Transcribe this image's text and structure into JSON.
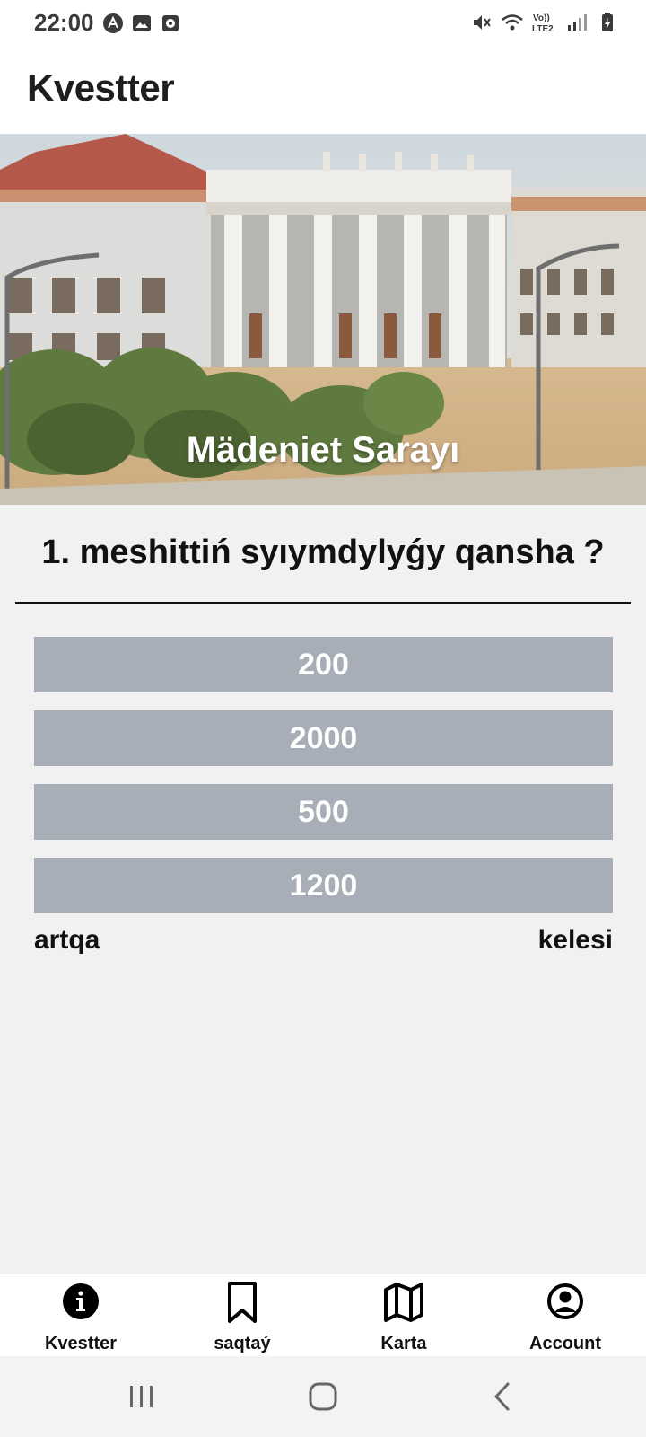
{
  "status_bar": {
    "time": "22:00",
    "left_icons": [
      "app-icon",
      "image-icon",
      "media-icon"
    ],
    "right_icons": [
      "mute-icon",
      "wifi-icon",
      "volte-icon",
      "signal-icon",
      "battery-icon"
    ],
    "network_label": "Vo)) LTE2"
  },
  "app_bar": {
    "title": "Kvestter"
  },
  "hero": {
    "caption": "Mädeniet Sarayı"
  },
  "quiz": {
    "question": "1. meshittiń syıymdylyǵy qansha ?",
    "answers": [
      "200",
      "2000",
      "500",
      "1200"
    ],
    "back_label": "artqa",
    "next_label": "kelesi"
  },
  "bottom_nav": {
    "tabs": [
      {
        "label": "Kvestter",
        "icon": "info-icon"
      },
      {
        "label": "saqtaý",
        "icon": "bookmark-icon"
      },
      {
        "label": "Karta",
        "icon": "map-icon"
      },
      {
        "label": "Account",
        "icon": "account-icon"
      }
    ]
  },
  "colors": {
    "answer_button": "#a7aeb7",
    "background": "#f1f1f1",
    "text": "#111111"
  }
}
